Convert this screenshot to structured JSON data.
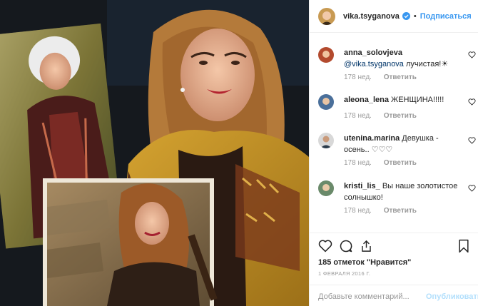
{
  "post": {
    "author": "vika.tsyganova",
    "follow_label": "Подписаться",
    "separator": "•"
  },
  "comments": [
    {
      "user": "anna_solovjeva",
      "mention": "@vika.tsyganova",
      "text": " лучистая!☀",
      "time": "178 нед.",
      "reply": "Ответить"
    },
    {
      "user": "aleona_lena",
      "mention": "",
      "text": " ЖЕНЩИНА!!!!!",
      "time": "178 нед.",
      "reply": "Ответить"
    },
    {
      "user": "utenina.marina",
      "mention": "",
      "text": " Девушка - осень.. ♡♡♡",
      "time": "178 нед.",
      "reply": "Ответить"
    },
    {
      "user": "kristi_lis_",
      "mention": "",
      "text": " Вы наше золотистое солнышко!",
      "time": "178 нед.",
      "reply": "Ответить"
    }
  ],
  "actions": {
    "likes": "185 отметок \"Нравится\"",
    "date": "1 ФЕВРАЛЯ 2016 Г.",
    "comment_placeholder": "Добавьте комментарий...",
    "publish_label": "Опубликовать"
  },
  "icons": {
    "verified": "verified-badge-icon",
    "like": "heart-icon",
    "comment": "comment-icon",
    "share": "share-icon",
    "save": "bookmark-icon"
  },
  "colors": {
    "accent": "#3897f0",
    "verified": "#3897f0",
    "muted": "#999999",
    "coat": "#c89a2a"
  }
}
